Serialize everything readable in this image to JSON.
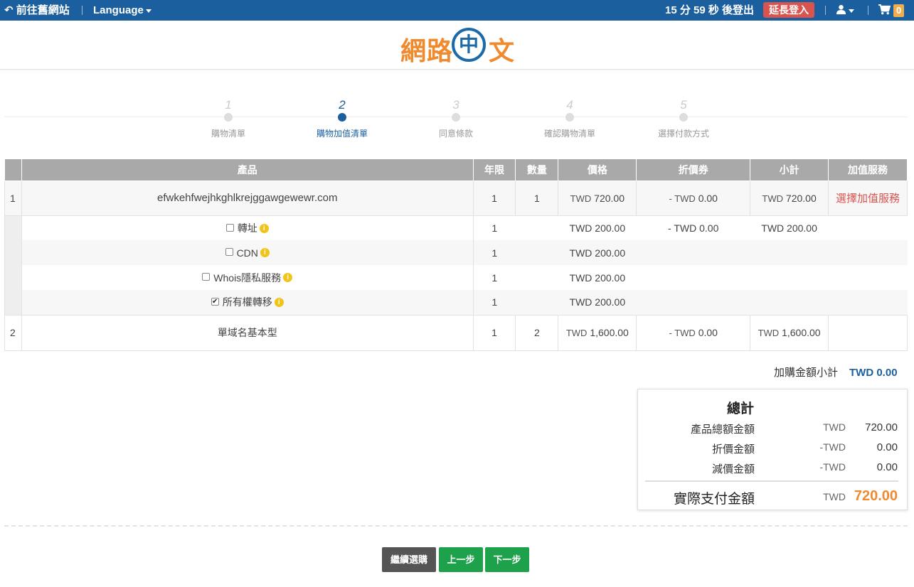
{
  "topbar": {
    "back_label": "前往舊網站",
    "language_label": "Language",
    "countdown_text": "15 分 59 秒 後登出",
    "extend_label": "延長登入",
    "cart_count": "0"
  },
  "logo": {
    "text_left": "網路",
    "text_circle": "中",
    "text_right": "文"
  },
  "steps": [
    {
      "num": "1",
      "label": "購物清單"
    },
    {
      "num": "2",
      "label": "購物加值清單"
    },
    {
      "num": "3",
      "label": "同意條款"
    },
    {
      "num": "4",
      "label": "確認購物清單"
    },
    {
      "num": "5",
      "label": "選擇付款方式"
    }
  ],
  "table": {
    "headers": [
      "",
      "產品",
      "年限",
      "數量",
      "價格",
      "折價券",
      "小計",
      "加值服務"
    ],
    "row1": {
      "index": "1",
      "product": "efwkehfwejhkghlkrejggawgewewr.com",
      "years": "1",
      "qty": "1",
      "price_cur": "TWD",
      "price": "720.00",
      "coupon_cur": "- TWD",
      "coupon": "0.00",
      "subtotal_cur": "TWD",
      "subtotal": "720.00",
      "vas_link": "選擇加值服務"
    },
    "addons": [
      {
        "name": "轉址",
        "checked": false,
        "years": "1",
        "price": "TWD 200.00",
        "coupon": "- TWD 0.00",
        "subtotal": "TWD 200.00"
      },
      {
        "name": "CDN",
        "checked": false,
        "years": "1",
        "price": "TWD 200.00",
        "coupon": "",
        "subtotal": ""
      },
      {
        "name": "Whois隱私服務",
        "checked": false,
        "years": "1",
        "price": "TWD 200.00",
        "coupon": "",
        "subtotal": ""
      },
      {
        "name": "所有權轉移",
        "checked": true,
        "years": "1",
        "price": "TWD 200.00",
        "coupon": "",
        "subtotal": ""
      }
    ],
    "row2": {
      "index": "2",
      "product": "單域名基本型",
      "years": "1",
      "qty": "2",
      "price_cur": "TWD",
      "price": "1,600.00",
      "coupon_cur": "- TWD",
      "coupon": "0.00",
      "subtotal_cur": "TWD",
      "subtotal": "1,600.00"
    }
  },
  "addon_subtotal": {
    "label": "加購金額小計",
    "value": "TWD 0.00"
  },
  "summary": {
    "title": "總計",
    "product_total": {
      "label": "產品總額金額",
      "cur": "TWD",
      "amount": "720.00"
    },
    "discount": {
      "label": "折價金額",
      "cur": "-TWD",
      "amount": "0.00"
    },
    "reduction": {
      "label": "減價金額",
      "cur": "-TWD",
      "amount": "0.00"
    },
    "actual": {
      "label": "實際支付金額",
      "cur": "TWD",
      "amount": "720.00"
    }
  },
  "buttons": {
    "continue": "繼續選購",
    "prev": "上一步",
    "next": "下一步"
  },
  "colors": {
    "topbar": "#1b5f9e",
    "accent_orange": "#ef8a2e",
    "link_red": "#d9534f",
    "button_green": "#1ea14b"
  }
}
